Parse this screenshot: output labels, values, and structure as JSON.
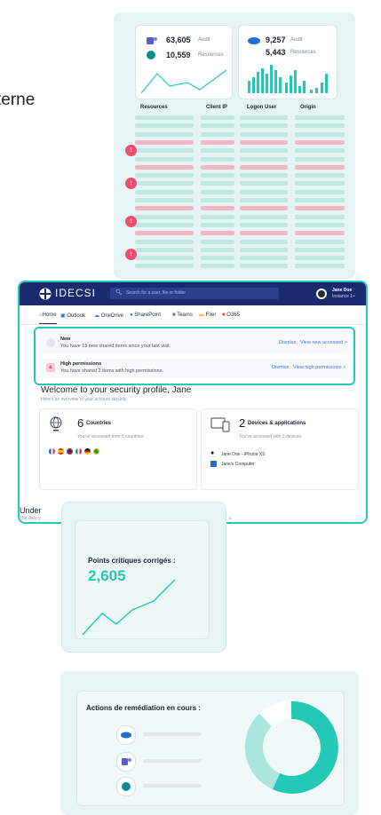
{
  "hero_text": "terne",
  "stats_card1": {
    "audit_value": "63,605",
    "audit_label": "Audit",
    "resources_value": "10,559",
    "resources_label": "Resources"
  },
  "stats_card2": {
    "audit_value": "9,257",
    "audit_label": "Audit",
    "resources_value": "5,443",
    "resources_label": "Resources"
  },
  "table": {
    "columns": [
      "Resources",
      "Client IP",
      "Logon User",
      "Origin"
    ]
  },
  "app": {
    "logo_text": "IDECSI",
    "search_placeholder": "Search for a user, file or folder",
    "user_name": "Jane Doe",
    "user_tenant": "Instance 1",
    "nav": [
      "Home",
      "Outlook",
      "OneDrive",
      "SharePoint",
      "Teams",
      "Filer",
      "O365"
    ]
  },
  "alerts": {
    "new": {
      "title": "New",
      "desc": "You have 15 new shared items since your last visit.",
      "dismiss": "Dismiss",
      "action": "View new accessed >"
    },
    "high": {
      "title": "High permissions",
      "desc": "You have shared 2 items with high permissions.",
      "dismiss": "Dismiss",
      "action": "View high permissions >"
    }
  },
  "welcome": {
    "title": "Welcome to your security profile, Jane",
    "subtitle": "Here's an overview of your account security"
  },
  "countries": {
    "count": "6",
    "label": "Countries",
    "desc": "You've accessed from 6 countries."
  },
  "devices": {
    "count": "2",
    "label": "Devices & applications",
    "desc": "You've accessed with 2 devices.",
    "items": [
      "Jane Doe - iPhone XS",
      "Jane's Computer"
    ]
  },
  "under": {
    "title": "Under",
    "text": "The data y",
    "tail": "s"
  },
  "points": {
    "title": "Points critiques corrigés :",
    "value": "2,605"
  },
  "remediation": {
    "title": "Actions de remédiation en cours :"
  },
  "colors": {
    "teal": "#23c8b7",
    "navy": "#1a2a6e",
    "pink": "#ee4d6d",
    "blue": "#1f6fd6"
  }
}
